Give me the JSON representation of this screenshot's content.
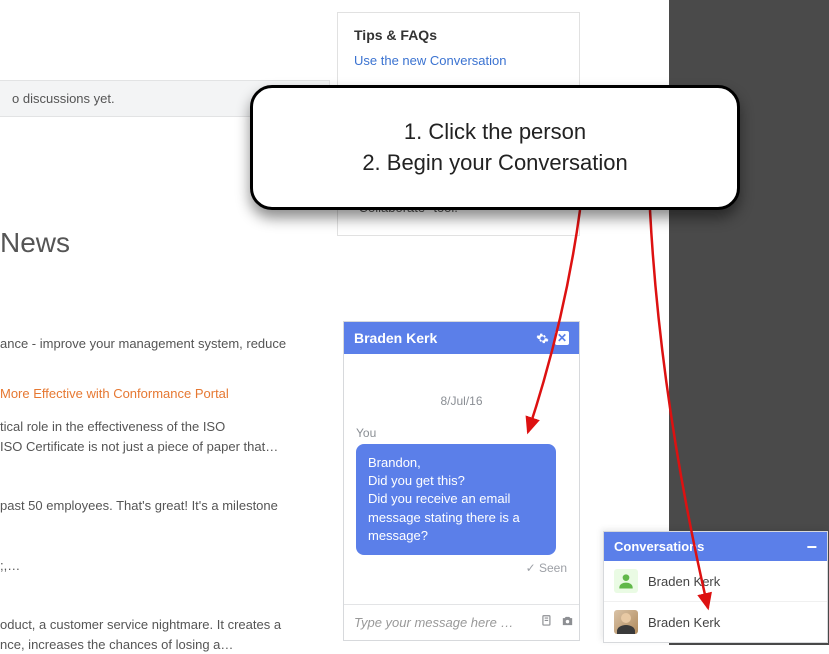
{
  "discussions_text": "o discussions yet.",
  "news_heading": "News",
  "articles": [
    {
      "snippet": "ance - improve your management system, reduce"
    },
    {
      "title_orange": "More Effective with Conformance Portal",
      "line1": "tical role in the effectiveness of the ISO",
      "line2": " ISO Certificate is not just a piece of paper that…"
    },
    {
      "line1": "past 50 employees. That's great! It's a milestone"
    },
    {
      "line1": ";,…"
    },
    {
      "line1": "oduct, a customer service nightmare. It creates a",
      "line2": "nce, increases the chances of losing a…"
    }
  ],
  "tips": {
    "heading": "Tips & FAQs",
    "link": "Use the new Conversation",
    "body_tail": "bottom of the screen in the \"Collaborate\" tool."
  },
  "callout": {
    "line1": "1. Click the person",
    "line2": "2. Begin your Conversation"
  },
  "chat": {
    "title": "Braden Kerk",
    "date": "8/Jul/16",
    "you_label": "You",
    "bubble": "Brandon,\nDid you get this?\nDid you receive an email message stating there is a message?",
    "seen": "Seen",
    "placeholder": "Type your message here …"
  },
  "conversations": {
    "title": "Conversations",
    "items": [
      {
        "name": "Braden Kerk",
        "avatar": "green"
      },
      {
        "name": "Braden Kerk",
        "avatar": "photo"
      }
    ]
  }
}
